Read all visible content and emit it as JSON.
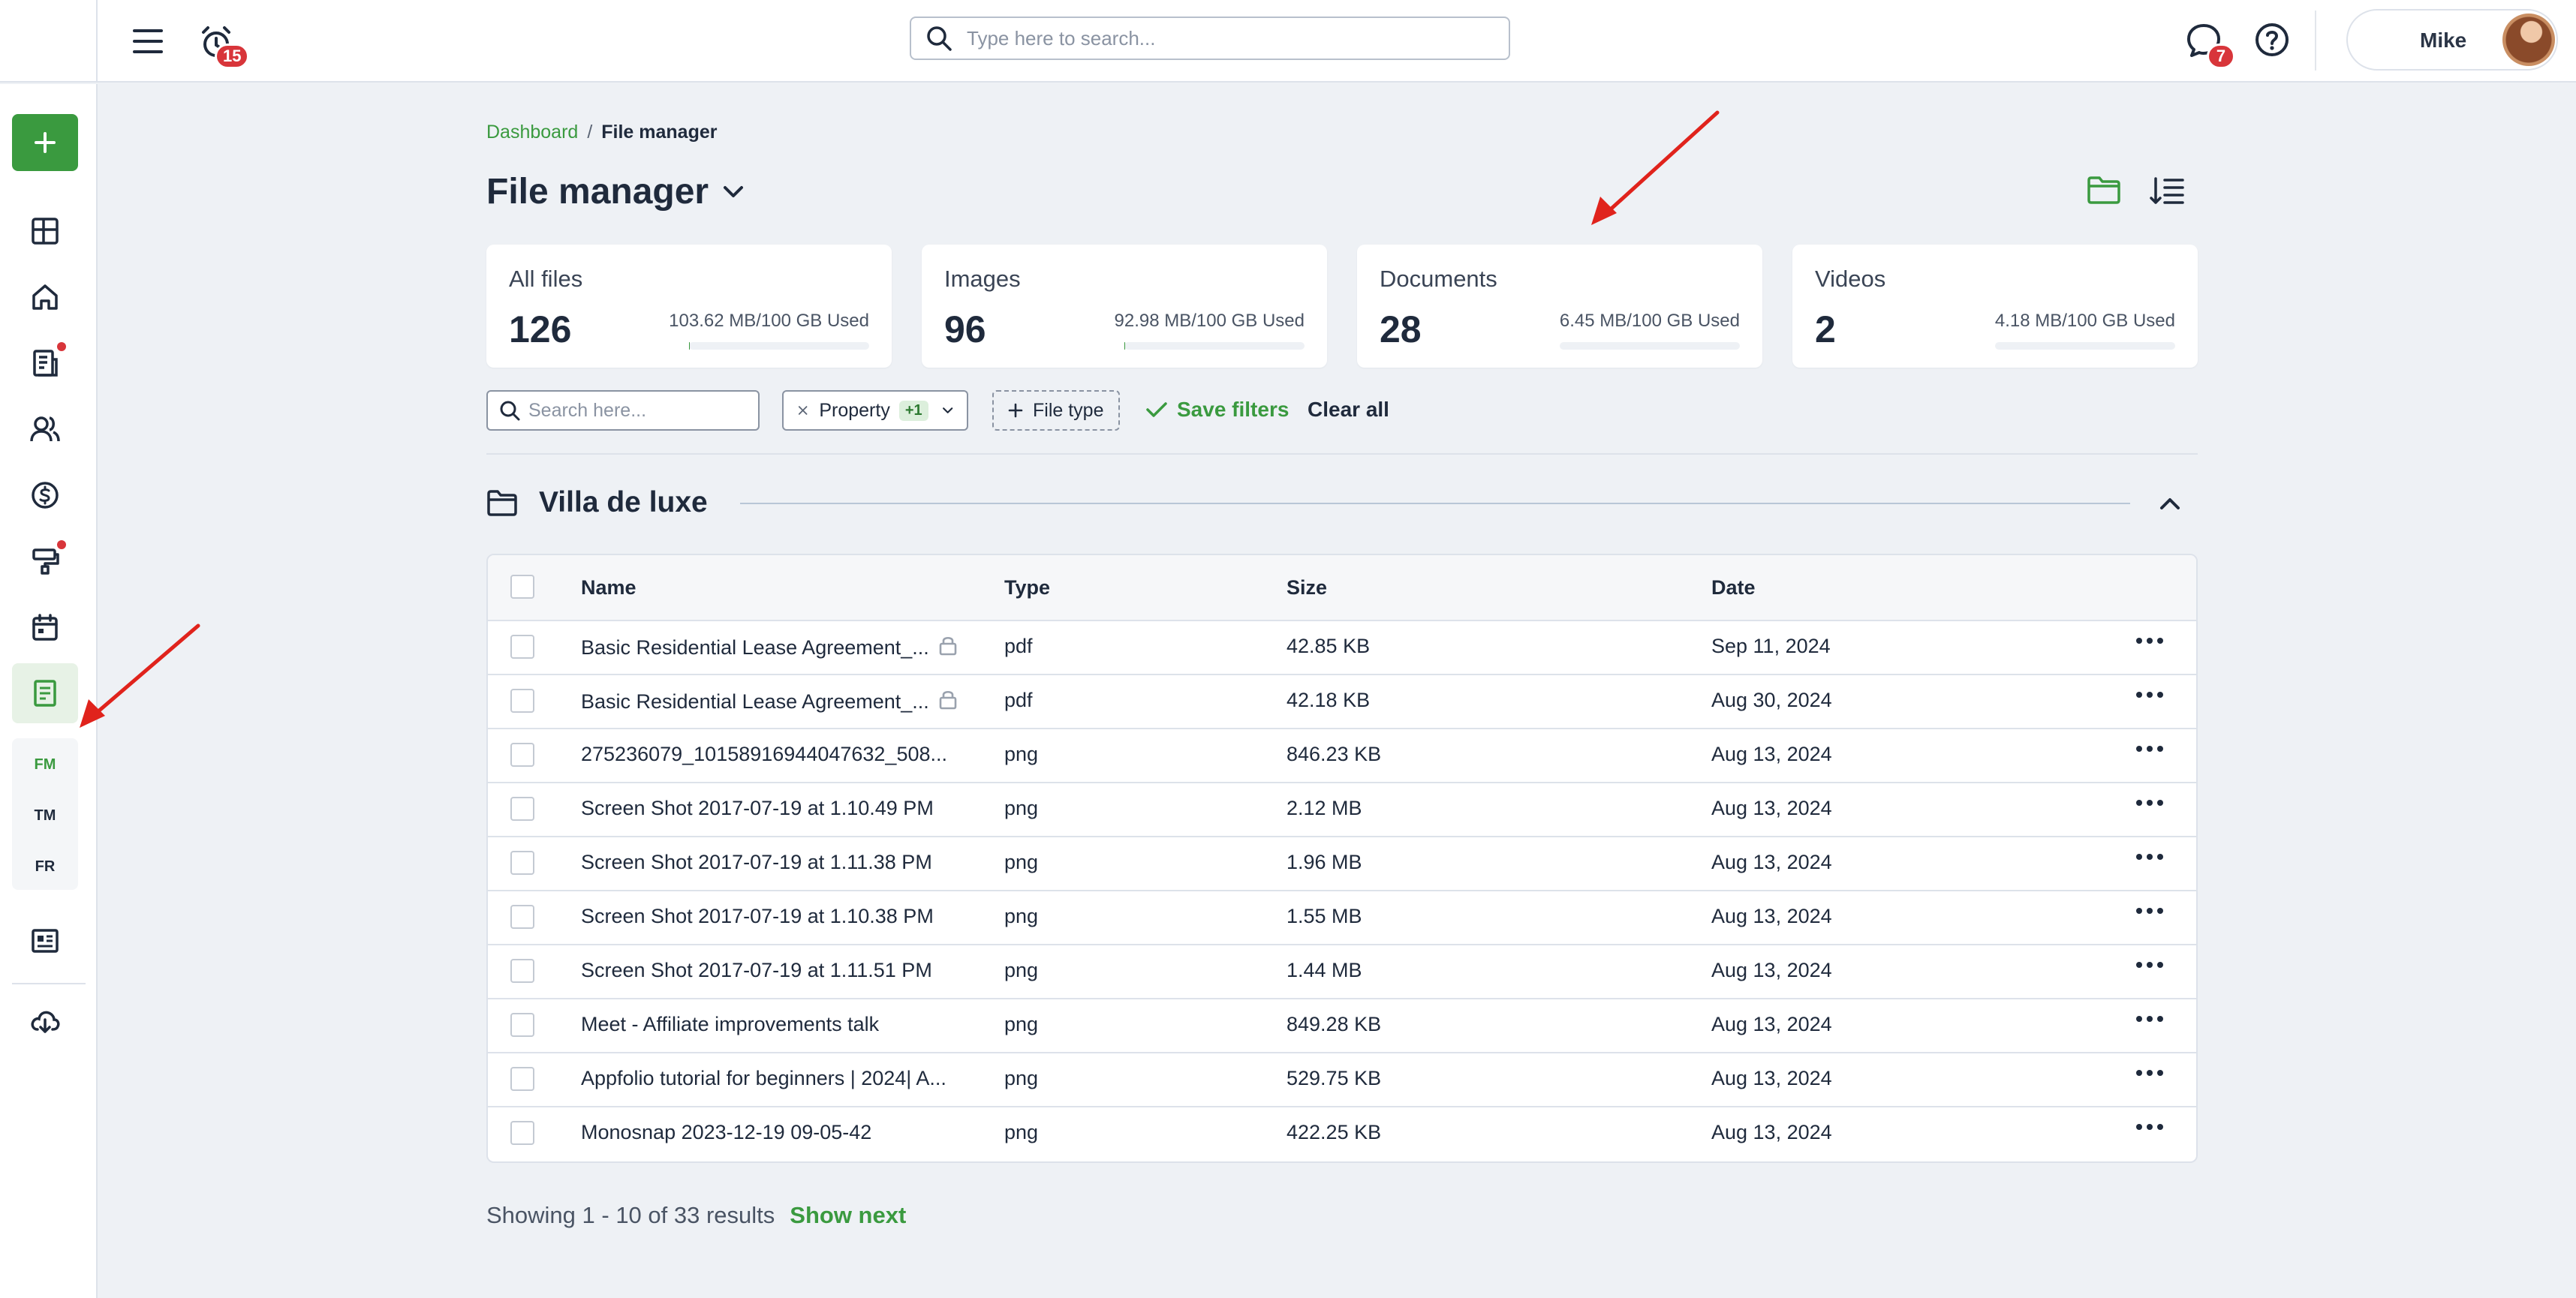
{
  "topbar": {
    "notifications_count": "15",
    "search_placeholder": "Type here to search...",
    "messages_count": "7",
    "user_name": "Mike"
  },
  "sidebar": {
    "items": [
      {
        "icon": "dashboard-icon"
      },
      {
        "icon": "home-icon"
      },
      {
        "icon": "reports-icon",
        "dot": true
      },
      {
        "icon": "people-icon"
      },
      {
        "icon": "dollar-icon"
      },
      {
        "icon": "maintenance-icon",
        "dot": true
      },
      {
        "icon": "calendar-icon"
      },
      {
        "icon": "file-icon",
        "active": true
      },
      {
        "icon": "listing-icon"
      },
      {
        "icon": "cloud-download-icon"
      }
    ],
    "sub_items": [
      "FM",
      "TM",
      "FR"
    ]
  },
  "breadcrumb": {
    "parent": "Dashboard",
    "separator": "/",
    "current": "File manager"
  },
  "page_title": "File manager",
  "stats": [
    {
      "label": "All files",
      "count": "126",
      "used": "103.62 MB/100 GB Used",
      "usage_fraction": 0.001
    },
    {
      "label": "Images",
      "count": "96",
      "used": "92.98 MB/100 GB Used",
      "usage_fraction": 0.0009
    },
    {
      "label": "Documents",
      "count": "28",
      "used": "6.45 MB/100 GB Used",
      "usage_fraction": 0.0001
    },
    {
      "label": "Videos",
      "count": "2",
      "used": "4.18 MB/100 GB Used",
      "usage_fraction": 4e-05
    }
  ],
  "filters": {
    "search_placeholder": "Search here...",
    "property_label": "Property",
    "property_count": "+1",
    "file_type_label": "File type",
    "save_label": "Save filters",
    "clear_label": "Clear all"
  },
  "group": {
    "title": "Villa de luxe"
  },
  "table": {
    "columns": [
      "Name",
      "Type",
      "Size",
      "Date"
    ],
    "rows": [
      {
        "name": "Basic Residential Lease Agreement_...",
        "locked": true,
        "type": "pdf",
        "size": "42.85 KB",
        "date": "Sep 11, 2024"
      },
      {
        "name": "Basic Residential Lease Agreement_...",
        "locked": true,
        "type": "pdf",
        "size": "42.18 KB",
        "date": "Aug 30, 2024"
      },
      {
        "name": "275236079_10158916944047632_508...",
        "locked": false,
        "type": "png",
        "size": "846.23 KB",
        "date": "Aug 13, 2024"
      },
      {
        "name": "Screen Shot 2017-07-19 at 1.10.49 PM",
        "locked": false,
        "type": "png",
        "size": "2.12 MB",
        "date": "Aug 13, 2024"
      },
      {
        "name": "Screen Shot 2017-07-19 at 1.11.38 PM",
        "locked": false,
        "type": "png",
        "size": "1.96 MB",
        "date": "Aug 13, 2024"
      },
      {
        "name": "Screen Shot 2017-07-19 at 1.10.38 PM",
        "locked": false,
        "type": "png",
        "size": "1.55 MB",
        "date": "Aug 13, 2024"
      },
      {
        "name": "Screen Shot 2017-07-19 at 1.11.51 PM",
        "locked": false,
        "type": "png",
        "size": "1.44 MB",
        "date": "Aug 13, 2024"
      },
      {
        "name": "Meet - Affiliate improvements talk",
        "locked": false,
        "type": "png",
        "size": "849.28 KB",
        "date": "Aug 13, 2024"
      },
      {
        "name": "Appfolio tutorial for beginners | 2024| A...",
        "locked": false,
        "type": "png",
        "size": "529.75 KB",
        "date": "Aug 13, 2024"
      },
      {
        "name": "Monosnap 2023-12-19 09-05-42",
        "locked": false,
        "type": "png",
        "size": "422.25 KB",
        "date": "Aug 13, 2024"
      }
    ]
  },
  "pagination": {
    "summary": "Showing 1 - 10 of 33 results",
    "next_label": "Show next"
  },
  "colors": {
    "accent": "#3a9a3f",
    "badge": "#d8353a",
    "annotation_arrow": "#e0231c"
  }
}
